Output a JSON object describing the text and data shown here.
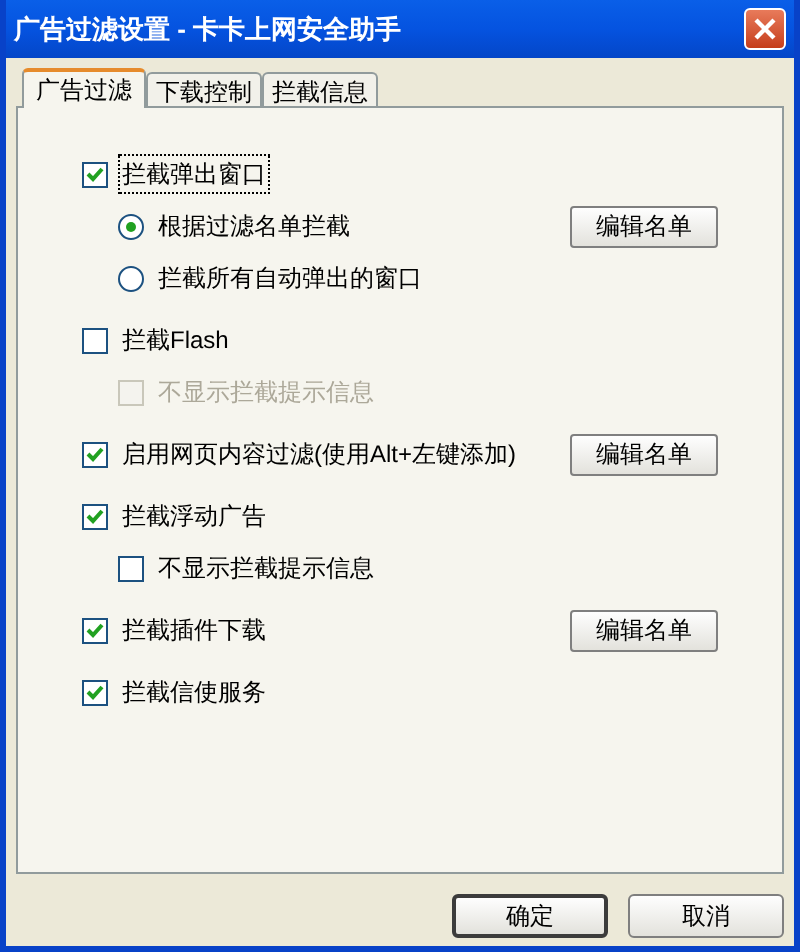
{
  "window": {
    "title": "广告过滤设置 - 卡卡上网安全助手"
  },
  "tabs": [
    {
      "label": "广告过滤",
      "selected": true
    },
    {
      "label": "下载控制",
      "selected": false
    },
    {
      "label": "拦截信息",
      "selected": false
    }
  ],
  "options": [
    {
      "kind": "checkbox",
      "label": "拦截弹出窗口",
      "checked": true,
      "focused": true,
      "children": [
        {
          "kind": "radio",
          "label": "根据过滤名单拦截",
          "selected": true,
          "button": "编辑名单"
        },
        {
          "kind": "radio",
          "label": "拦截所有自动弹出的窗口",
          "selected": false
        }
      ]
    },
    {
      "kind": "checkbox",
      "label": "拦截Flash",
      "checked": false,
      "children": [
        {
          "kind": "checkbox",
          "label": "不显示拦截提示信息",
          "checked": false,
          "disabled": true
        }
      ]
    },
    {
      "kind": "checkbox",
      "label": "启用网页内容过滤(使用Alt+左键添加)",
      "checked": true,
      "button": "编辑名单"
    },
    {
      "kind": "checkbox",
      "label": "拦截浮动广告",
      "checked": true,
      "children": [
        {
          "kind": "checkbox",
          "label": "不显示拦截提示信息",
          "checked": false
        }
      ]
    },
    {
      "kind": "checkbox",
      "label": "拦截插件下载",
      "checked": true,
      "button": "编辑名单"
    },
    {
      "kind": "checkbox",
      "label": "拦截信使服务",
      "checked": true
    }
  ],
  "buttons": [
    {
      "label": "确定",
      "default": true
    },
    {
      "label": "取消",
      "default": false
    }
  ]
}
